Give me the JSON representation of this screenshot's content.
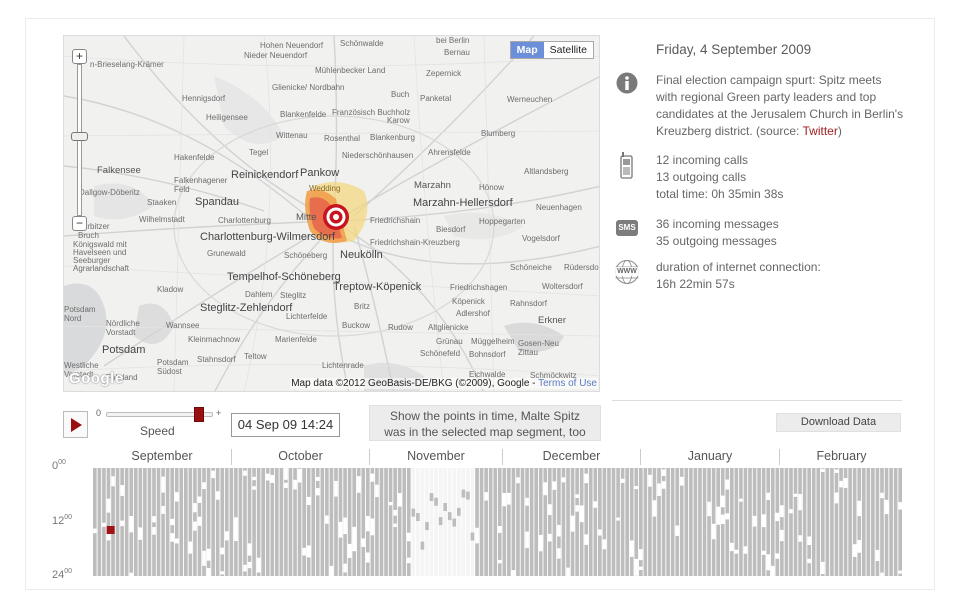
{
  "info": {
    "date": "Friday, 4 September 2009",
    "event_text": "Final election campaign spurt: Spitz meets with regional Green party leaders and top candidates at the Jerusalem Church in Berlin's Kreuzberg district. (source: ",
    "event_source_link": "Twitter",
    "event_text_end": ")",
    "calls": [
      "12 incoming calls",
      "13 outgoing calls",
      "total time: 0h 35min 38s"
    ],
    "messages": [
      "36 incoming messages",
      "35 outgoing messages"
    ],
    "internet": [
      "duration of internet connection:",
      "16h 22min 57s"
    ],
    "sms_icon_text": "SMS",
    "www_icon_text": "WWW"
  },
  "map": {
    "type_buttons": [
      "Map",
      "Satellite"
    ],
    "active_type": "Map",
    "attribution": "Map data ©2012 GeoBasis-DE/BKG (©2009), Google - ",
    "terms_link": "Terms of Use",
    "logo": "Google",
    "places": [
      "Hohen Neuendorf",
      "Schönwalde",
      "bei Berlin",
      "Bernau",
      "Nieder Neuendorf",
      "Birkenwerder",
      "Mühlenbecker Land",
      "Zepernick",
      "n-Brieselang-Krämer",
      "Glienicke/ Nordbahn",
      "Hennigsdorf",
      "Buch",
      "Panketal",
      "Werneuchen",
      "Heiligensee",
      "Blankenfelde",
      "Französisch Buchholz",
      "Karow",
      "Wittenau",
      "Rosenthal",
      "Blankenburg",
      "Blumberg",
      "Tegel",
      "Hakenfelde",
      "Niederschönhausen",
      "Ahrensfelde",
      "Falkensee",
      "Reinickendorf",
      "Pankow",
      "Altlandsberg",
      "Falkenhagener Feld",
      "Marzahn",
      "Hönow",
      "Dallgow-Döberitz",
      "Wedding",
      "Staaken",
      "Spandau",
      "Marzahn-Hellersdorf",
      "Neuenhagen",
      "Wilhelmstadt",
      "Charlottenburg",
      "Mitte",
      "Friedrichshain",
      "Hoppegarten",
      "Biesdorf",
      "Charlottenburg-Wilmersdorf",
      "Friedrichshain-Kreuzberg",
      "Vogelsdorf",
      "Königswald mit Havelseen und Seeburger Agrarlandschaft",
      "Grunewald",
      "Schöneberg",
      "Neukölln",
      "Schöneiche",
      "Rüdersdorf",
      "Tempelhof-Schöneberg",
      "Kladow",
      "Treptow-Köpenick",
      "Friedrichshagen",
      "Woltersdorf",
      "Dahlem",
      "Steglitz",
      "Britz",
      "Köpenick",
      "Rahnsdorf",
      "Steglitz-Zehlendorf",
      "Lichterfelde",
      "Adlershof",
      "Potsdam Nord",
      "Nördliche Vorstadt",
      "Wannsee",
      "Buckow",
      "Rudow",
      "Altglienicke",
      "Erkner",
      "Kleinmachnow",
      "Marienfelde",
      "Grünau",
      "Müggelheim",
      "Gosen-Neu Zittau",
      "Potsdam",
      "Stahnsdorf",
      "Teltow",
      "Schönefeld",
      "Bohnsdorf",
      "Potsdam Südost",
      "Lichtenrade",
      "Eichwalde",
      "Schmöckwitz",
      "Westliche Vorstadt",
      "Fahrland",
      "Ferbitzer Bruch",
      "Falkensee",
      "Staaken",
      "Werder"
    ]
  },
  "controls": {
    "speed_min": "0",
    "speed_max": "+",
    "speed_label": "Speed",
    "speed_value": 0.88,
    "current_time": "04 Sep 09 14:24",
    "points_button": [
      "Show the points in time, Malte Spitz",
      "was in the selected map segment, too"
    ],
    "download_button": "Download Data"
  },
  "timeline": {
    "months": [
      "September",
      "October",
      "November",
      "December",
      "January",
      "February"
    ],
    "hours": [
      {
        "label": "0",
        "sup": "00"
      },
      {
        "label": "12",
        "sup": "00"
      },
      {
        "label": "24",
        "sup": "00"
      }
    ],
    "colors": {
      "active": "#bdbdbd",
      "empty": "#f5f5f5",
      "highlight": "#a01414"
    }
  }
}
